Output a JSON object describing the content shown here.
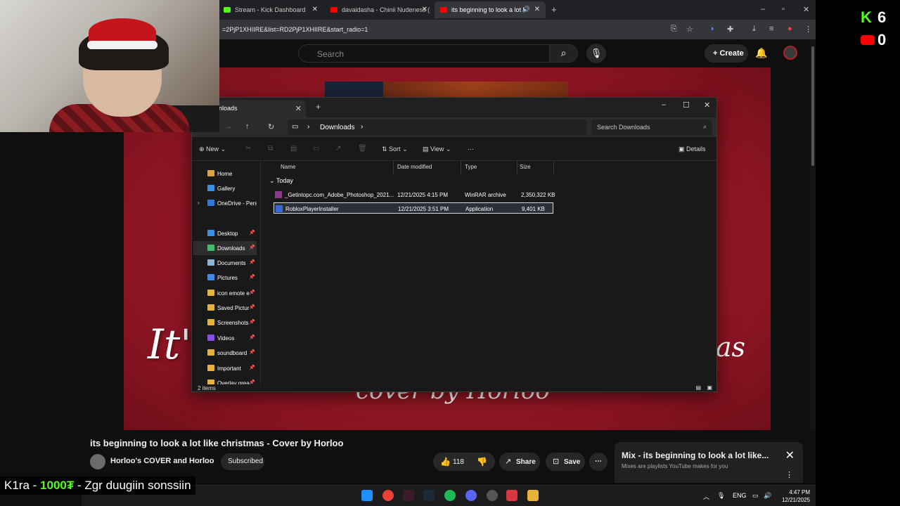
{
  "browser": {
    "tabs": [
      {
        "label": "Stream - Kick Dashboard",
        "color": "#53fc18"
      },
      {
        "label": "davaidasha - Chinii Nudeness (",
        "color": "#ff0000"
      },
      {
        "label": "its beginning to look a lot l",
        "color": "#ff0000"
      }
    ],
    "url": "=2PjP1XHIIRE&list=RD2PjP1XHIIRE&start_radio=1"
  },
  "youtube": {
    "search_placeholder": "Search",
    "create_label": "Create",
    "video_title_art_1": "It'",
    "video_title_art_2": "as",
    "video_title_art_3": "cover by Horloo",
    "video_title": "its beginning to look a lot like christmas - Cover by Horloo",
    "channel": "Horloo's COVER and Horloo",
    "subscribed": "Subscribed",
    "likes": "118",
    "share": "Share",
    "save": "Save",
    "mix_title": "Mix - its beginning to look a lot like...",
    "mix_sub": "Mixes are playlists YouTube makes for you"
  },
  "explorer": {
    "tab_title": "nloads",
    "path": "Downloads",
    "search_placeholder": "Search Downloads",
    "toolbar": {
      "new": "New",
      "sort": "Sort",
      "view": "View",
      "details": "Details"
    },
    "nav_items": [
      {
        "label": "Home",
        "color": "#d9a441"
      },
      {
        "label": "Gallery",
        "color": "#3a8ee6"
      },
      {
        "label": "OneDrive - Pers",
        "color": "#2b7ad8"
      },
      {
        "label": "Desktop",
        "color": "#3a8ee6"
      },
      {
        "label": "Downloads",
        "color": "#3fbf6a"
      },
      {
        "label": "Documents",
        "color": "#8ab4d8"
      },
      {
        "label": "Pictures",
        "color": "#3a8ee6"
      },
      {
        "label": "icon emote e",
        "color": "#e6b43a"
      },
      {
        "label": "Saved Pictur",
        "color": "#e6b43a"
      },
      {
        "label": "Screenshots",
        "color": "#e6b43a"
      },
      {
        "label": "Videos",
        "color": "#8a4ee6"
      },
      {
        "label": "soundboard",
        "color": "#e6b43a"
      },
      {
        "label": "Important",
        "color": "#e6b43a"
      },
      {
        "label": "Overlay grea",
        "color": "#e6b43a"
      }
    ],
    "columns": [
      "Name",
      "Date modified",
      "Type",
      "Size"
    ],
    "group": "Today",
    "files": [
      {
        "name": "_Getintopc.com_Adobe_Photoshop_2021...",
        "date": "12/21/2025 4:15 PM",
        "type": "WinRAR archive",
        "size": "2,350,322 KB"
      },
      {
        "name": "RobloxPlayerInstaller",
        "date": "12/21/2025 3:51 PM",
        "type": "Application",
        "size": "9,401 KB"
      }
    ],
    "status": "2 items"
  },
  "chat": {
    "prefix": "K1ra - ",
    "amount": "1000₮",
    "message": " - Zgr duugiin sonssiin"
  },
  "overlay": {
    "kick_count": "6",
    "yt_count": "0"
  },
  "taskbar": {
    "lang": "ENG",
    "time": "4:47 PM",
    "date": "12/21/2025"
  }
}
